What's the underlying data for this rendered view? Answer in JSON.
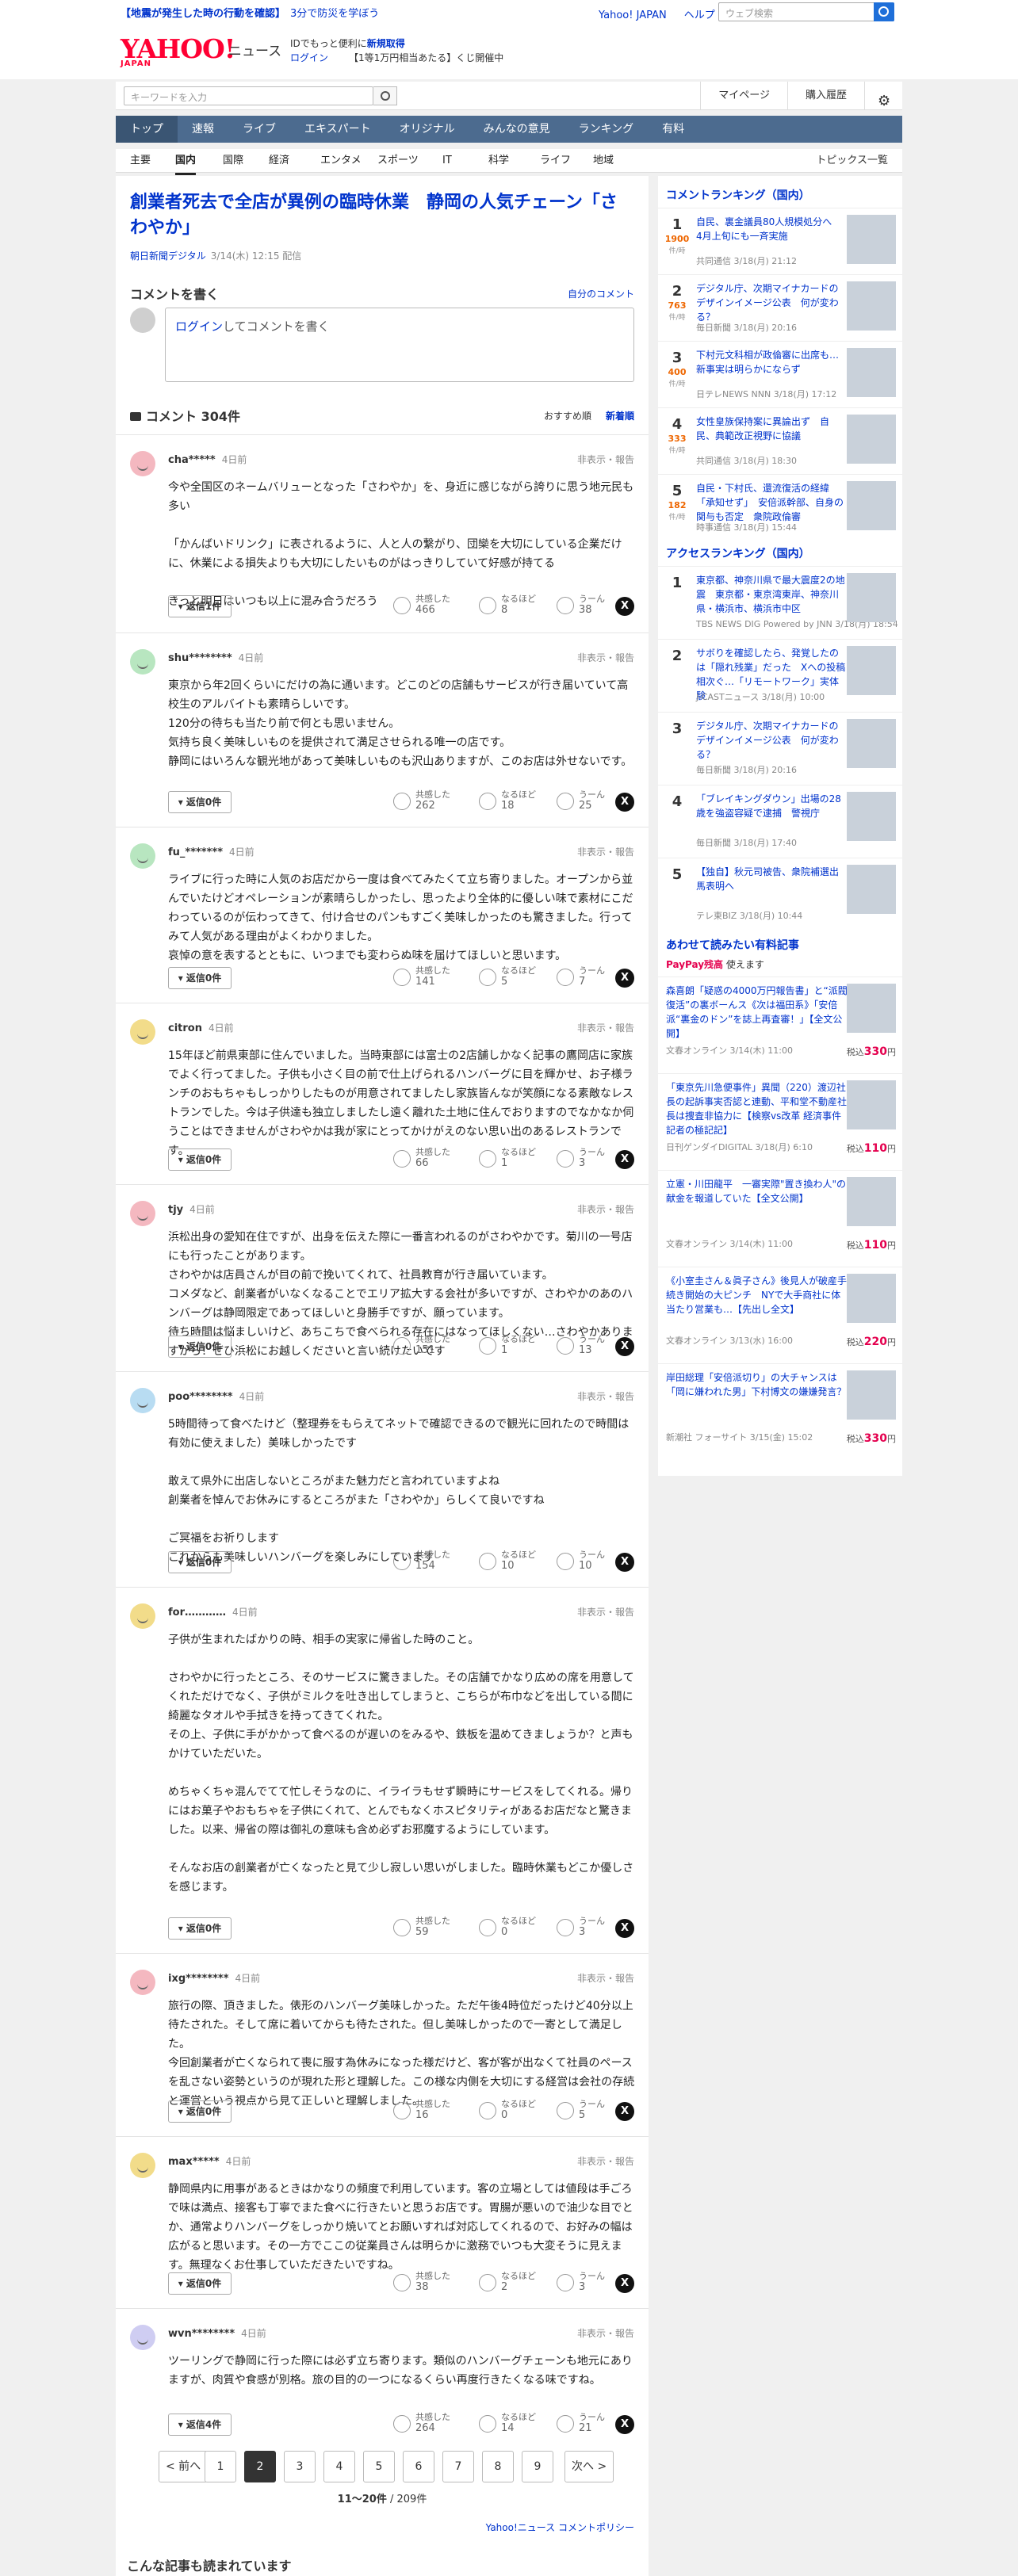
{
  "header": {
    "alert_1": "【地震が発生した時の行動を確認】",
    "alert_2": "3分で防災を学ぼう",
    "link_yahoo_japan": "Yahoo! JAPAN",
    "link_help": "ヘルプ",
    "web_search_placeholder": "ウェブ検索",
    "logo": "YAHOO!",
    "logo_sub": "JAPAN",
    "service_name": "ニュース",
    "id_text_1": "IDでもっと便利に",
    "id_text_bold": "新規取得",
    "login": "ログイン",
    "lottery": "【1等1万円相当あたる】くじ開催中",
    "keyword_placeholder": "キーワードを入力",
    "mypage": "マイページ",
    "purchase_history": "購入履歴"
  },
  "nav": {
    "tabs": [
      "トップ",
      "速報",
      "ライブ",
      "エキスパート",
      "オリジナル",
      "みんなの意見",
      "ランキング",
      "有料"
    ],
    "active": "トップ"
  },
  "subnav": {
    "tabs": [
      "主要",
      "国内",
      "国際",
      "経済",
      "エンタメ",
      "スポーツ",
      "IT",
      "科学",
      "ライフ",
      "地域"
    ],
    "active": "国内",
    "topics": "トピックス一覧"
  },
  "article": {
    "title": "創業者死去で全店が異例の臨時休業　静岡の人気チェーン「さわやか」",
    "source": "朝日新聞デジタル",
    "datetime": "3/14(木) 12:15 配信"
  },
  "comment_write": {
    "label": "コメントを書く",
    "my_comments": "自分のコメント",
    "login_link": "ログイン",
    "prompt": "してコメントを書く"
  },
  "comments_header": {
    "title": "コメント 304件",
    "sort_recommended": "おすすめ順",
    "sort_newest": "新着順"
  },
  "reaction_labels": {
    "agree": "共感した",
    "insightful": "なるほど",
    "hmm": "うーん"
  },
  "hide_report": "非表示・報告",
  "comments": [
    {
      "user": "cha*****",
      "date": "4日前",
      "avatar_color": "#f4b8c0",
      "text": "今や全国区のネームバリューとなった「さわやか」を、身近に感じながら誇りに思う地元民も多い\n\n「かんばいドリンク」に表されるように、人と人の繋がり、団欒を大切にしている企業だけに、休業による損失よりも大切にしたいものがはっきりしていて好感が持てる\n\nきっと明日はいつも以上に混み合うだろう",
      "replies": "返信1件",
      "agree": "466",
      "insightful": "8",
      "hmm": "38"
    },
    {
      "user": "shu********",
      "date": "4日前",
      "avatar_color": "#b8e6c0",
      "text": "東京から年2回くらいにだけの為に通います。どこのどの店舗もサービスが行き届いていて高校生のアルバイトも素晴らしいです。\n120分の待ちも当たり前で何とも思いません。\n気持ち良く美味しいものを提供されて満足させられる唯一の店です。\n静岡にはいろんな観光地があって美味しいものも沢山ありますが、このお店は外せないです。",
      "replies": "返信0件",
      "agree": "262",
      "insightful": "18",
      "hmm": "25"
    },
    {
      "user": "fu_*******",
      "date": "4日前",
      "avatar_color": "#b8e6c0",
      "text": "ライブに行った時に人気のお店だから一度は食べてみたくて立ち寄りました。オープンから並んでいたけどオペレーションが素晴らしかったし、思ったより全体的に優しい味で素材にこだわっているのが伝わってきて、付け合せのパンもすごく美味しかったのも驚きました。行ってみて人気がある理由がよくわかりました。\n哀悼の意を表するとともに、いつまでも変わらぬ味を届けてほしいと思います。",
      "replies": "返信0件",
      "agree": "141",
      "insightful": "5",
      "hmm": "7"
    },
    {
      "user": "citron",
      "date": "4日前",
      "avatar_color": "#f2dc8a",
      "text": "15年ほど前県東部に住んでいました。当時東部には富士の2店舗しかなく記事の鷹岡店に家族でよく行ってました。子供も小さく目の前で仕上げられるハンバーグに目を輝かせ、お子様ランチのおもちゃもしっかりしたものが用意されてましたし家族皆んなが笑顔になる素敵なレストランでした。今は子供達も独立しましたし遠く離れた土地に住んでおりますのでなかなか伺うことはできませんがさわやかは我が家にとってかけがえのない思い出のあるレストランです。",
      "replies": "返信0件",
      "agree": "66",
      "insightful": "1",
      "hmm": "3"
    },
    {
      "user": "tjy",
      "date": "4日前",
      "avatar_color": "#f4b8c0",
      "text": "浜松出身の愛知在住ですが、出身を伝えた際に一番言われるのがさわやかです。菊川の一号店にも行ったことがあります。\nさわやかは店員さんが目の前で挽いてくれて、社員教育が行き届いています。\nコメダなど、創業者がいなくなることでエリア拡大する会社が多いですが、さわやかのあのハンバーグは静岡限定であってほしいと身勝手ですが、願っています。\n待ち時間は悩ましいけど、あちこちで食べられる存在にはなってほしくない…さわやかありますから！ぜひ浜松にお越しくださいと言い続けたいです",
      "replies": "返信0件",
      "agree": "151",
      "insightful": "1",
      "hmm": "13"
    },
    {
      "user": "poo********",
      "date": "4日前",
      "avatar_color": "#b8dcf2",
      "text": "5時間待って食べたけど（整理券をもらえてネットで確認できるので観光に回れたので時間は有効に使えました）美味しかったです\n\n敢えて県外に出店しないところがまた魅力だと言われていますよね\n創業者を悼んでお休みにするところがまた「さわやか」らしくて良いですね\n\nご冥福をお祈りします\nこれからも美味しいハンバーグを楽しみにしています",
      "replies": "返信0件",
      "agree": "154",
      "insightful": "10",
      "hmm": "10"
    },
    {
      "user": "for…………",
      "date": "4日前",
      "avatar_color": "#f2dc8a",
      "text": "子供が生まれたばかりの時、相手の実家に帰省した時のこと。\n\nさわやかに行ったところ、そのサービスに驚きました。その店舗でかなり広めの席を用意してくれただけでなく、子供がミルクを吐き出してしまうと、こちらが布巾などを出している間に綺麗なタオルや手拭きを持ってきてくれた。\nその上、子供に手がかかって食べるのが遅いのをみるや、鉄板を温めてきましょうか？と声もかけていただいた。\n\nめちゃくちゃ混んでてて忙しそうなのに、イライラもせず瞬時にサービスをしてくれる。帰りにはお菓子やおもちゃを子供にくれて、とんでもなくホスピタリティがあるお店だなと驚きました。以来、帰省の際は御礼の意味も含め必ずお邪魔するようにしています。\n\nそんなお店の創業者が亡くなったと見て少し寂しい思いがしました。臨時休業もどこか優しさを感じます。",
      "replies": "返信0件",
      "agree": "59",
      "insightful": "0",
      "hmm": "3"
    },
    {
      "user": "ixg********",
      "date": "4日前",
      "avatar_color": "#f4b8c0",
      "text": "旅行の際、頂きました。俵形のハンバーグ美味しかった。ただ午後4時位だったけど40分以上待たされた。そして席に着いてからも待たされた。但し美味しかったので一寄として満足した。\n今回創業者が亡くなられて喪に服す為休みになった様だけど、客が客が出なくて社員のペースを乱さない姿勢というのが現れた形と理解した。この様な内側を大切にする経営は会社の存続と運営という視点から見て正しいと理解しました。",
      "replies": "返信0件",
      "agree": "16",
      "insightful": "0",
      "hmm": "5"
    },
    {
      "user": "max*****",
      "date": "4日前",
      "avatar_color": "#f2dc8a",
      "text": "静岡県内に用事があるときはかなりの頻度で利用しています。客の立場としては値段は手ごろで味は満点、接客も丁寧でまた食べに行きたいと思うお店です。胃腸が悪いので油少な目でとか、通常よりハンバーグをしっかり焼いてとお願いすれば対応してくれるので、お好みの幅は広がると思います。その一方でここの従業員さんは明らかに激務でいつも大変そうに見えます。無理なくお仕事していただきたいですね。",
      "replies": "返信0件",
      "agree": "38",
      "insightful": "2",
      "hmm": "3"
    },
    {
      "user": "wvn********",
      "date": "4日前",
      "avatar_color": "#cfcdf2",
      "text": "ツーリングで静岡に行った際には必ず立ち寄ります。類似のハンバーグチェーンも地元にありますが、肉質や食感が別格。旅の目的の一つになるくらい再度行きたくなる味ですね。",
      "replies": "返信4件",
      "agree": "264",
      "insightful": "14",
      "hmm": "21"
    }
  ],
  "pager": {
    "prev": "< 前へ",
    "next": "次へ >",
    "pages": [
      "1",
      "2",
      "3",
      "4",
      "5",
      "6",
      "7",
      "8",
      "9"
    ],
    "current": "2",
    "info_range": "11〜20件",
    "info_total": "/ 209件"
  },
  "policy_link": "Yahoo!ニュース コメントポリシー",
  "related_heading": "こんな記事も読まれています",
  "sidebar": {
    "comment_ranking_title": "コメントランキング（国内）",
    "comment_label": "件/時",
    "comment_ranking": [
      {
        "rank": "1",
        "count": "1900",
        "title": "自民、裏金議員80人規模処分へ　4月上旬にも一斉実施",
        "source": "共同通信 3/18(月) 21:12"
      },
      {
        "rank": "2",
        "count": "763",
        "title": "デジタル庁、次期マイナカードのデザインイメージ公表　何が変わる？",
        "source": "毎日新聞 3/18(月) 20:16"
      },
      {
        "rank": "3",
        "count": "400",
        "title": "下村元文科相が政倫審に出席も…新事実は明らかにならず",
        "source": "日テレNEWS NNN 3/18(月) 17:12"
      },
      {
        "rank": "4",
        "count": "333",
        "title": "女性皇族保持案に異論出ず　自民、典範改正視野に協議",
        "source": "共同通信 3/18(月) 18:30"
      },
      {
        "rank": "5",
        "count": "182",
        "title": "自民・下村氏、還流復活の経緯「承知せず」　安倍派幹部、自身の関与も否定　衆院政倫審",
        "source": "時事通信 3/18(月) 15:44"
      }
    ],
    "access_ranking_title": "アクセスランキング（国内）",
    "access_ranking": [
      {
        "rank": "1",
        "title": "東京都、神奈川県で最大震度2の地震　東京都・東京湾東岸、神奈川県・横浜市、横浜市中区",
        "source": "TBS NEWS DIG Powered by JNN 3/18(月) 18:54"
      },
      {
        "rank": "2",
        "title": "サボりを確認したら、発覚したのは「隠れ残業」だった　Xへの投稿相次ぐ…「リモートワーク」実体験",
        "source": "J-CASTニュース 3/18(月) 10:00"
      },
      {
        "rank": "3",
        "title": "デジタル庁、次期マイナカードのデザインイメージ公表　何が変わる？",
        "source": "毎日新聞 3/18(月) 20:16"
      },
      {
        "rank": "4",
        "title": "「ブレイキングダウン」出場の28歳を強盗容疑で逮捕　警視庁",
        "source": "毎日新聞 3/18(月) 17:40"
      },
      {
        "rank": "5",
        "title": "【独自】秋元司被告、衆院補選出馬表明へ",
        "source": "テレ東BIZ 3/18(月) 10:44"
      }
    ],
    "paid_title": "あわせて読みたい有料記事",
    "paypay": "PayPay残高",
    "paypay_suffix": "使えます",
    "paid_label": "税込",
    "paid": [
      {
        "title": "森喜朗「疑惑の4000万円報告書」と“派閥復活”の裏ボーんス《次は福田系》「安倍派“裏金のドン”を誌上再査審！」【全文公開】",
        "source": "文春オンライン 3/14(木) 11:00",
        "price": "330",
        "unit": "円"
      },
      {
        "title": "「東京先川急便事件」異聞（220）渡辺社長の起訴事実否認と連動、平和堂不動産社長は捜査非協力に【検察vs改革 経済事件記者の極記記】",
        "source": "日刊ゲンダイDIGITAL 3/18(月) 6:10",
        "price": "110",
        "unit": "円"
      },
      {
        "title": "立憲・川田龍平　一審実際\"置き換わ人\"の献金を報道していた【全文公開】",
        "source": "文春オンライン 3/14(木) 11:00",
        "price": "110",
        "unit": "円"
      },
      {
        "title": "《小室圭さん＆眞子さん》後見人が破産手続き開始の大ピンチ　NYで大手商社に体当たり営業も…【先出し全文】",
        "source": "文春オンライン 3/13(水) 16:00",
        "price": "220",
        "unit": "円"
      },
      {
        "title": "岸田総理「安倍派切り」の大チャンスは「岡に嫌われた男」下村博文の嫌嫌発言？",
        "source": "新潮社 フォーサイト 3/15(金) 15:02",
        "price": "330",
        "unit": "円"
      }
    ]
  }
}
